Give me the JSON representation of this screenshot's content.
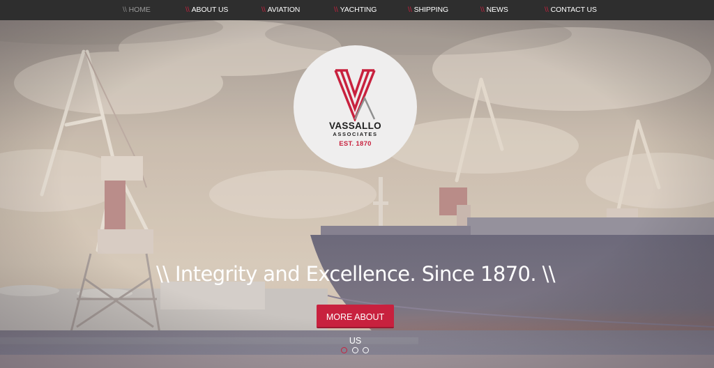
{
  "nav": {
    "items": [
      {
        "prefix": "\\\\",
        "label": "HOME",
        "active": true
      },
      {
        "prefix": "\\\\",
        "label": "ABOUT US",
        "active": false
      },
      {
        "prefix": "\\\\",
        "label": "AVIATION",
        "active": false
      },
      {
        "prefix": "\\\\",
        "label": "YACHTING",
        "active": false
      },
      {
        "prefix": "\\\\",
        "label": "SHIPPING",
        "active": false
      },
      {
        "prefix": "\\\\",
        "label": "NEWS",
        "active": false
      },
      {
        "prefix": "\\\\",
        "label": "CONTACT US",
        "active": false
      }
    ]
  },
  "logo": {
    "name": "VASSALLO",
    "sub": "ASSOCIATES",
    "est": "EST. 1870"
  },
  "hero": {
    "tagline": "\\\\ Integrity and Excellence. Since 1870. \\\\",
    "cta_label": "MORE ABOUT US",
    "slides": [
      {
        "active": true
      },
      {
        "active": false
      },
      {
        "active": false
      }
    ]
  },
  "colors": {
    "accent": "#c8213e",
    "nav_bg": "#2e2e2e",
    "logo_bg": "#efeeee",
    "text_light": "#ffffff"
  }
}
